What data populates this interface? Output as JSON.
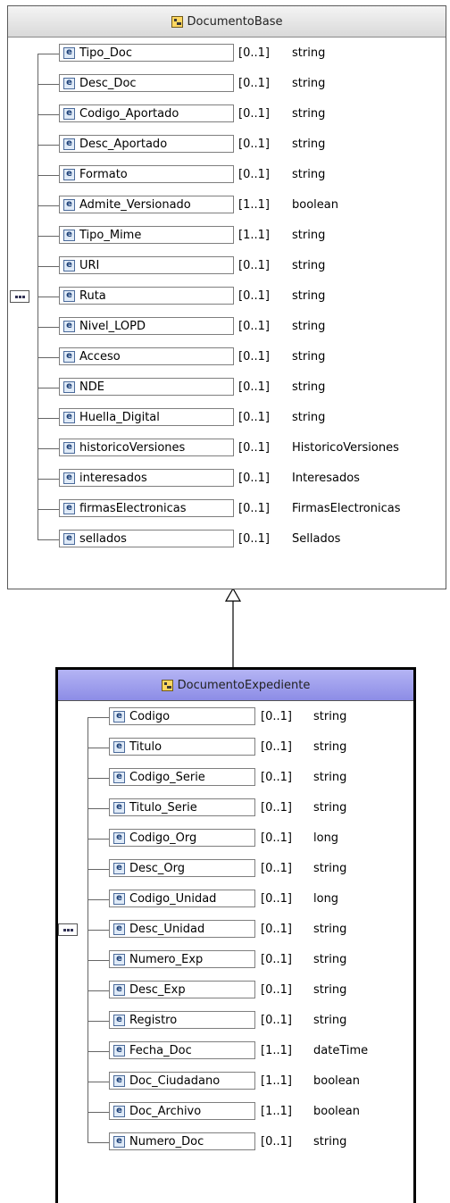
{
  "diagram": {
    "base": {
      "title": "DocumentoBase",
      "elements": [
        {
          "icon": "e",
          "name": "Tipo_Doc",
          "card": "[0..1]",
          "type": "string"
        },
        {
          "icon": "e",
          "name": "Desc_Doc",
          "card": "[0..1]",
          "type": "string"
        },
        {
          "icon": "e",
          "name": "Codigo_Aportado",
          "card": "[0..1]",
          "type": "string"
        },
        {
          "icon": "e",
          "name": "Desc_Aportado",
          "card": "[0..1]",
          "type": "string"
        },
        {
          "icon": "e",
          "name": "Formato",
          "card": "[0..1]",
          "type": "string"
        },
        {
          "icon": "e",
          "name": "Admite_Versionado",
          "card": "[1..1]",
          "type": "boolean"
        },
        {
          "icon": "e",
          "name": "Tipo_Mime",
          "card": "[1..1]",
          "type": "string"
        },
        {
          "icon": "e",
          "name": "URI",
          "card": "[0..1]",
          "type": "string"
        },
        {
          "icon": "e",
          "name": "Ruta",
          "card": "[0..1]",
          "type": "string"
        },
        {
          "icon": "e",
          "name": "Nivel_LOPD",
          "card": "[0..1]",
          "type": "string"
        },
        {
          "icon": "e",
          "name": "Acceso",
          "card": "[0..1]",
          "type": "string"
        },
        {
          "icon": "e",
          "name": "NDE",
          "card": "[0..1]",
          "type": "string"
        },
        {
          "icon": "e",
          "name": "Huella_Digital",
          "card": "[0..1]",
          "type": "string"
        },
        {
          "icon": "e",
          "name": "historicoVersiones",
          "card": "[0..1]",
          "type": "HistoricoVersiones"
        },
        {
          "icon": "e",
          "name": "interesados",
          "card": "[0..1]",
          "type": "Interesados"
        },
        {
          "icon": "e",
          "name": "firmasElectronicas",
          "card": "[0..1]",
          "type": "FirmasElectronicas"
        },
        {
          "icon": "e",
          "name": "sellados",
          "card": "[0..1]",
          "type": "Sellados"
        }
      ]
    },
    "derived": {
      "title": "DocumentoExpediente",
      "elements": [
        {
          "icon": "e",
          "name": "Codigo",
          "card": "[0..1]",
          "type": "string"
        },
        {
          "icon": "e",
          "name": "Titulo",
          "card": "[0..1]",
          "type": "string"
        },
        {
          "icon": "e",
          "name": "Codigo_Serie",
          "card": "[0..1]",
          "type": "string"
        },
        {
          "icon": "e",
          "name": "Titulo_Serie",
          "card": "[0..1]",
          "type": "string"
        },
        {
          "icon": "e",
          "name": "Codigo_Org",
          "card": "[0..1]",
          "type": "long"
        },
        {
          "icon": "e",
          "name": "Desc_Org",
          "card": "[0..1]",
          "type": "string"
        },
        {
          "icon": "e",
          "name": "Codigo_Unidad",
          "card": "[0..1]",
          "type": "long"
        },
        {
          "icon": "e",
          "name": "Desc_Unidad",
          "card": "[0..1]",
          "type": "string"
        },
        {
          "icon": "e",
          "name": "Numero_Exp",
          "card": "[0..1]",
          "type": "string"
        },
        {
          "icon": "e",
          "name": "Desc_Exp",
          "card": "[0..1]",
          "type": "string"
        },
        {
          "icon": "e",
          "name": "Registro",
          "card": "[0..1]",
          "type": "string"
        },
        {
          "icon": "e",
          "name": "Fecha_Doc",
          "card": "[1..1]",
          "type": "dateTime"
        },
        {
          "icon": "e",
          "name": "Doc_Ciudadano",
          "card": "[1..1]",
          "type": "boolean"
        },
        {
          "icon": "e",
          "name": "Doc_Archivo",
          "card": "[1..1]",
          "type": "boolean"
        },
        {
          "icon": "e",
          "name": "Numero_Doc",
          "card": "[0..1]",
          "type": "string"
        }
      ]
    }
  }
}
